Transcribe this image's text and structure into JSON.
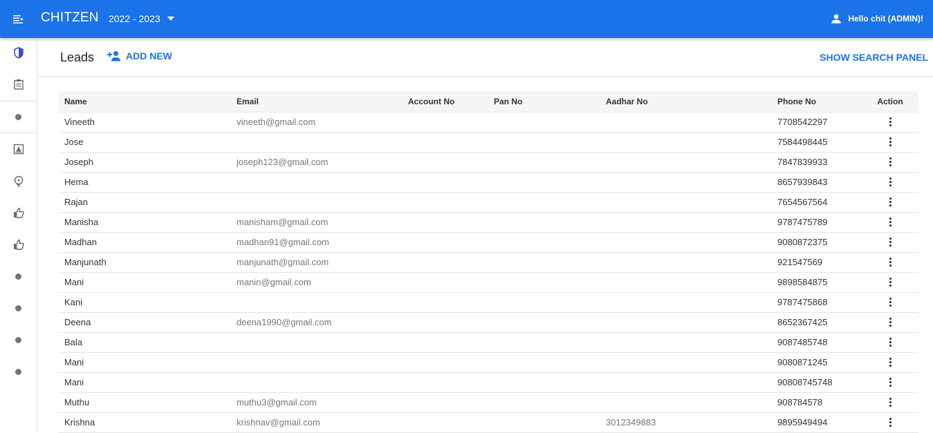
{
  "app": {
    "brand": "CHITZEN",
    "year": "2022 - 2023",
    "user_greeting": "Hello chit (ADMIN)!"
  },
  "colors": {
    "primary": "#1a73e8",
    "sidebar_shield": "#3f51b5"
  },
  "sidebar": {
    "items": [
      {
        "icon": "shield-icon"
      },
      {
        "icon": "clipboard-icon"
      },
      {
        "icon": "dot-icon"
      },
      {
        "icon": "account-box-icon"
      },
      {
        "icon": "lightbulb-icon"
      },
      {
        "icon": "thumb-up-icon"
      },
      {
        "icon": "thumb-up-icon"
      },
      {
        "icon": "dot-icon"
      },
      {
        "icon": "dot-icon"
      },
      {
        "icon": "dot-icon"
      },
      {
        "icon": "dot-icon"
      }
    ]
  },
  "header": {
    "title": "Leads",
    "add_new": "ADD NEW",
    "search_panel": "SHOW SEARCH PANEL"
  },
  "table": {
    "columns": [
      "Name",
      "Email",
      "Account No",
      "Pan No",
      "Aadhar No",
      "Phone No",
      "Action"
    ],
    "rows": [
      {
        "name": "Vineeth",
        "email": "vineeth@gmail.com",
        "account": "",
        "pan": "",
        "aadhar": "",
        "phone": "7708542297"
      },
      {
        "name": "Jose",
        "email": "",
        "account": "",
        "pan": "",
        "aadhar": "",
        "phone": "7584498445"
      },
      {
        "name": "Joseph",
        "email": "joseph123@gmail.com",
        "account": "",
        "pan": "",
        "aadhar": "",
        "phone": "7847839933"
      },
      {
        "name": "Hema",
        "email": "",
        "account": "",
        "pan": "",
        "aadhar": "",
        "phone": "8657939843"
      },
      {
        "name": "Rajan",
        "email": "",
        "account": "",
        "pan": "",
        "aadhar": "",
        "phone": "7654567564"
      },
      {
        "name": "Manisha",
        "email": "manisham@gmail.com",
        "account": "",
        "pan": "",
        "aadhar": "",
        "phone": "9787475789"
      },
      {
        "name": "Madhan",
        "email": "madhan91@gmail.com",
        "account": "",
        "pan": "",
        "aadhar": "",
        "phone": "9080872375"
      },
      {
        "name": "Manjunath",
        "email": "manjunath@gmail.com",
        "account": "",
        "pan": "",
        "aadhar": "",
        "phone": "921547569"
      },
      {
        "name": "Mani",
        "email": "manin@gmail.com",
        "account": "",
        "pan": "",
        "aadhar": "",
        "phone": "9898584875"
      },
      {
        "name": "Kani",
        "email": "",
        "account": "",
        "pan": "",
        "aadhar": "",
        "phone": "9787475868"
      },
      {
        "name": "Deena",
        "email": "deena1990@gmail.com",
        "account": "",
        "pan": "",
        "aadhar": "",
        "phone": "8652367425"
      },
      {
        "name": "Bala",
        "email": "",
        "account": "",
        "pan": "",
        "aadhar": "",
        "phone": "9087485748"
      },
      {
        "name": "Mani",
        "email": "",
        "account": "",
        "pan": "",
        "aadhar": "",
        "phone": "9080871245"
      },
      {
        "name": "Mani",
        "email": "",
        "account": "",
        "pan": "",
        "aadhar": "",
        "phone": "90808745748"
      },
      {
        "name": "Muthu",
        "email": "muthu3@gmail.com",
        "account": "",
        "pan": "",
        "aadhar": "",
        "phone": "908784578"
      },
      {
        "name": "Krishna",
        "email": "krishnav@gmail.com",
        "account": "",
        "pan": "",
        "aadhar": "3012349883",
        "phone": "9895949494"
      }
    ]
  }
}
